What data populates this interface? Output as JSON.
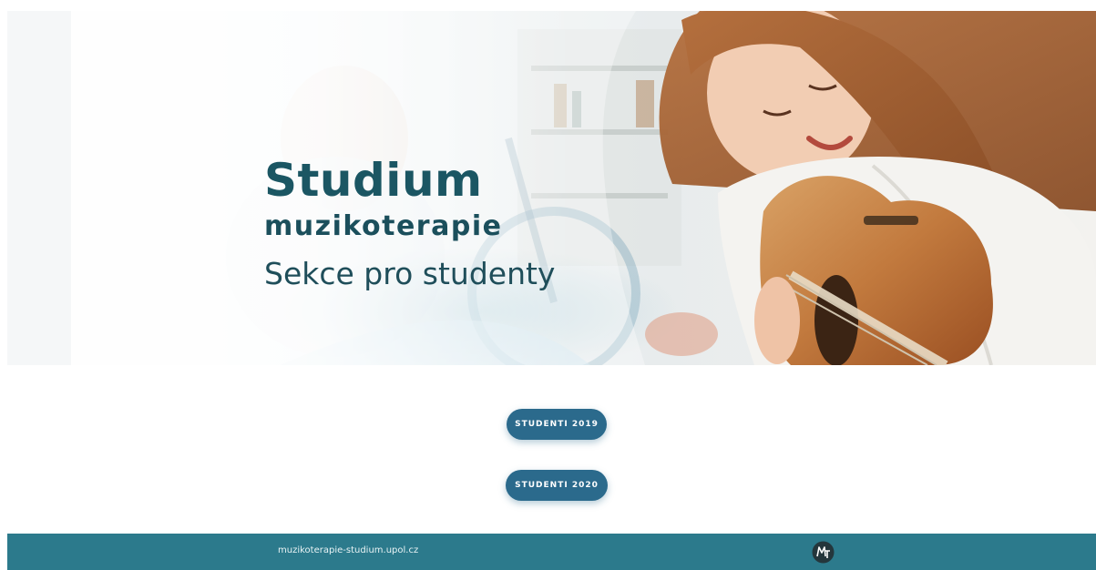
{
  "hero": {
    "title": "Studium",
    "subtitle": "muzikoterapie",
    "tagline": "Sekce pro studenty",
    "image": "guitar-student-photo"
  },
  "buttons": [
    {
      "label": "STUDENTI 2019"
    },
    {
      "label": "STUDENTI 2020"
    }
  ],
  "footer": {
    "link_text": "muzikoterapie-studium.upol.cz",
    "logo_icon": "mt-logo-icon"
  },
  "colors": {
    "title": "#1b5663",
    "button": "#2b6a8c",
    "footer": "#2c7a8c"
  }
}
